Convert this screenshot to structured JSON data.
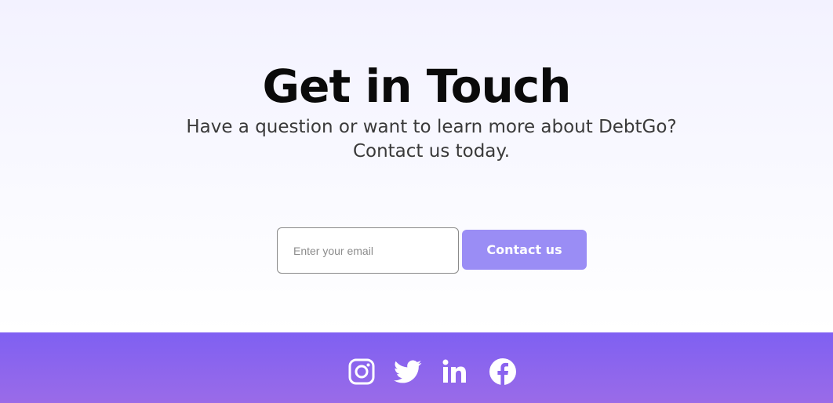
{
  "contact": {
    "title": "Get in Touch",
    "subtitle_line1": "Have a question or want to learn more about DebtGo?",
    "subtitle_line2": "Contact us today.",
    "email_placeholder": "Enter your email",
    "email_value": "",
    "button_label": "Contact us"
  },
  "footer": {
    "social_icons": [
      "instagram-icon",
      "twitter-icon",
      "linkedin-icon",
      "facebook-icon"
    ]
  },
  "colors": {
    "hero_top": "#f3f2ff",
    "button_bg": "#9a8df5",
    "footer_bg": "#7f60f2",
    "title_text": "#0a0a0a"
  }
}
